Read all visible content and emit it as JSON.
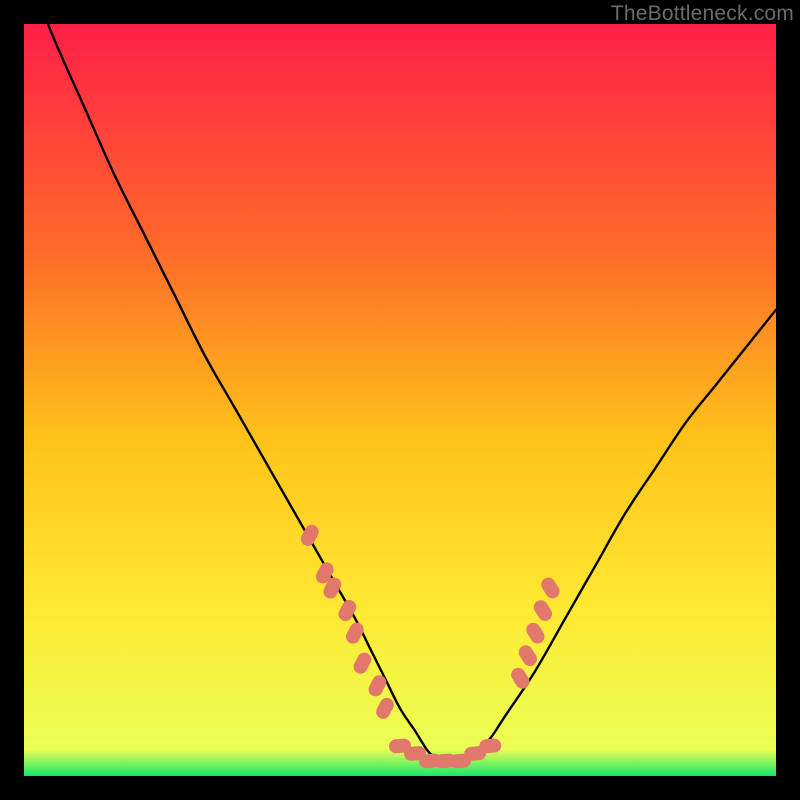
{
  "watermark": "TheBottleneck.com",
  "chart_data": {
    "type": "line",
    "title": "",
    "xlabel": "",
    "ylabel": "",
    "xlim": [
      0,
      100
    ],
    "ylim": [
      0,
      100
    ],
    "grid": false,
    "legend": false,
    "gradient_stops": [
      {
        "offset": 0,
        "color": "#ff1f47"
      },
      {
        "offset": 30,
        "color": "#ff6a2a"
      },
      {
        "offset": 55,
        "color": "#ffc21a"
      },
      {
        "offset": 78,
        "color": "#ffe933"
      },
      {
        "offset": 96.5,
        "color": "#e9ff55"
      },
      {
        "offset": 100,
        "color": "#17e66a"
      }
    ],
    "series": [
      {
        "name": "bottleneck-curve",
        "stroke": "#000000",
        "x": [
          0,
          4,
          8,
          12,
          16,
          20,
          24,
          28,
          32,
          36,
          40,
          44,
          46,
          48,
          50,
          52,
          54,
          56,
          58,
          60,
          62,
          64,
          68,
          72,
          76,
          80,
          84,
          88,
          92,
          96,
          100
        ],
        "y": [
          108,
          98,
          89,
          80,
          72,
          64,
          56,
          49,
          42,
          35,
          28,
          21,
          17,
          13,
          9,
          6,
          3,
          2,
          2,
          3,
          5,
          8,
          14,
          21,
          28,
          35,
          41,
          47,
          52,
          57,
          62
        ]
      }
    ],
    "dot_clusters": [
      {
        "name": "left-cluster",
        "color": "#e2786c",
        "points": [
          {
            "x": 38,
            "y": 32
          },
          {
            "x": 40,
            "y": 27
          },
          {
            "x": 41,
            "y": 25
          },
          {
            "x": 43,
            "y": 22
          },
          {
            "x": 44,
            "y": 19
          },
          {
            "x": 45,
            "y": 15
          },
          {
            "x": 47,
            "y": 12
          },
          {
            "x": 48,
            "y": 9
          }
        ]
      },
      {
        "name": "bottom-cluster",
        "color": "#e2786c",
        "points": [
          {
            "x": 50,
            "y": 4
          },
          {
            "x": 52,
            "y": 3
          },
          {
            "x": 54,
            "y": 2
          },
          {
            "x": 56,
            "y": 2
          },
          {
            "x": 58,
            "y": 2
          },
          {
            "x": 60,
            "y": 3
          },
          {
            "x": 62,
            "y": 4
          }
        ]
      },
      {
        "name": "right-cluster",
        "color": "#e2786c",
        "points": [
          {
            "x": 66,
            "y": 13
          },
          {
            "x": 67,
            "y": 16
          },
          {
            "x": 68,
            "y": 19
          },
          {
            "x": 69,
            "y": 22
          },
          {
            "x": 70,
            "y": 25
          }
        ]
      }
    ]
  }
}
